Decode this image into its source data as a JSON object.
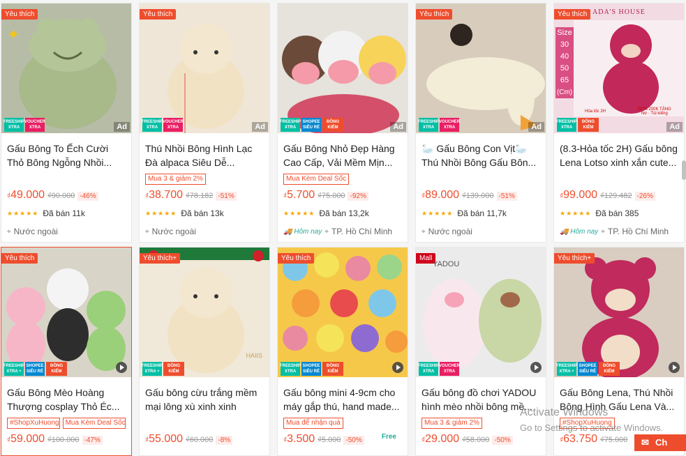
{
  "labels": {
    "ad": "Ad",
    "freeship": "FREESHIP",
    "xtra": "XTRA",
    "xtra_plus": "XTRA +",
    "voucher": "VOUCHER",
    "shopee": "SHOPEE",
    "sieu_re": "SIÊU RẺ",
    "dong": "ĐỒNG",
    "kiem": "KIỂM",
    "hom_nay": "Hôm nay",
    "currency": "₫",
    "freeship_icon": "Free"
  },
  "products": [
    {
      "tag": "Yêu thích",
      "title": "Gấu Bông To Ếch Cười Thỏ Bông Ngỗng Nhồi...",
      "promos": [],
      "price": "49.000",
      "old": "₫90.000",
      "disc": "-46%",
      "sold": "Đã bán 11k",
      "location": "Nước ngoài",
      "today": false,
      "bg": "#c9cfb9",
      "accent": "#a8b98a"
    },
    {
      "tag": "Yêu thích",
      "title": "Thú Nhồi Bông Hình Lạc Đà alpaca Siêu Dễ...",
      "promos": [
        "Mua 3 & giảm 2%"
      ],
      "price": "38.700",
      "old": "₫78.182",
      "disc": "-51%",
      "sold": "Đã bán 13k",
      "location": "Nước ngoài",
      "today": false,
      "bg": "#efe6d8",
      "accent": "#f2e2c4"
    },
    {
      "tag": "",
      "title": "Gấu Bông Nhỏ Đẹp Hàng Cao Cấp, Vải Mềm Mịn...",
      "promos": [
        "Mua Kèm Deal Sốc"
      ],
      "price": "5.700",
      "old": "₫75.000",
      "disc": "-92%",
      "sold": "Đã bán 13,2k",
      "location": "TP. Hồ Chí Minh",
      "today": true,
      "bg": "#e6e2dc",
      "accent": "#f49aa8"
    },
    {
      "tag": "Yêu thích",
      "title": "🦢 Gấu Bông Con Vịt🦢 Thú Nhồi Bông Gấu Bôn...",
      "promos": [],
      "price": "89.000",
      "old": "₫139.000",
      "disc": "-51%",
      "sold": "Đã bán 11,7k",
      "location": "Nước ngoài",
      "today": false,
      "bg": "#d8ccbc",
      "accent": "#f3ecd6"
    },
    {
      "tag": "Yêu thích",
      "title": "(8.3-Hỏa tốc 2H) Gấu bông Lena Lotso xinh xắn cute...",
      "promos": [],
      "price": "99.000",
      "old": "₫129.482",
      "disc": "-26%",
      "sold": "Đã bán 385",
      "location": "TP. Hồ Chí Minh",
      "today": true,
      "bg": "#f3dbe3",
      "accent": "#c2285a",
      "side": {
        "name": "ADA'S HOUSE",
        "size_label": "Size",
        "sizes": [
          "30",
          "40",
          "50",
          "65",
          "(Cm)"
        ],
        "ship": "Hỏa tốc 2H",
        "gift": "Nơ · Túi kiếng",
        "gift_title": "ĐƠN 200K TẶNG"
      }
    },
    {
      "tag": "Yêu thích",
      "title": "Gấu Bông Mèo Hoàng Thượng cosplay Thỏ Éc...",
      "promos": [
        "#ShopXuHuong",
        "Mua Kèm Deal Sốc"
      ],
      "price": "59.000",
      "old": "₫100.000",
      "disc": "-47%",
      "sold": "",
      "location": "",
      "today": false,
      "bg": "#d9d4c8",
      "accent": "#9bd07a",
      "highlight": true
    },
    {
      "tag": "Yêu thích+",
      "title": "Gấu bông cừu trắng mềm mại lông xù xinh xinh",
      "promos": [],
      "price": "55.000",
      "old": "₫60.000",
      "disc": "-8%",
      "sold": "",
      "location": "",
      "today": false,
      "bg": "#f0e8d8",
      "accent": "#f2e2c4",
      "corner": "HAIIS"
    },
    {
      "tag": "Yêu thích",
      "title": "Gấu bông mini 4-9cm cho máy gắp thú, hand made...",
      "promos": [
        "Mua để nhận quà"
      ],
      "price": "3.500",
      "old": "₫5.000",
      "disc": "-50%",
      "sold": "",
      "location": "",
      "today": false,
      "bg": "#f6c84a",
      "accent": "#e94c4c",
      "freeship_icon": true
    },
    {
      "tag": "Mall",
      "title": "Gấu bông đồ chơi YADOU hình mèo nhồi bông mề...",
      "promos": [
        "Mua 3 & giảm 2%"
      ],
      "price": "29.000",
      "old": "₫58.000",
      "disc": "-50%",
      "sold": "",
      "location": "",
      "today": false,
      "bg": "#ebebeb",
      "accent": "#f6c5d2",
      "brand": "YADOU"
    },
    {
      "tag": "Yêu thích+",
      "title": "Gấu Bông Lena, Thú Nhồi Bông Hình Gấu Lena Và...",
      "promos": [
        "#ShopXuHuong"
      ],
      "price": "63.750",
      "old": "₫75.000",
      "disc": "",
      "sold": "",
      "location": "",
      "today": false,
      "bg": "#d9ccc0",
      "accent": "#c02a5c"
    }
  ],
  "watermark": {
    "line1": "Activate Windows",
    "line2": "Go to Settings to activate Windows."
  },
  "chat": {
    "label": "Ch"
  },
  "colors": {
    "primary": "#ee4d2d",
    "star": "#f6a700",
    "teal": "#26aa99"
  }
}
